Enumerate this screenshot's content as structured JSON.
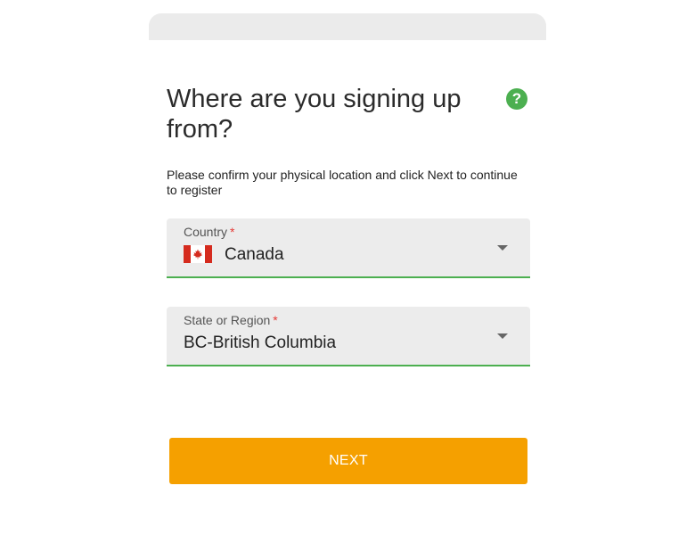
{
  "header": {
    "title": "Where are you signing up from?",
    "help_icon": "question-mark-icon",
    "help_symbol": "?"
  },
  "instructions": "Please confirm your physical location and click Next to continue to register",
  "form": {
    "country": {
      "label": "Country",
      "required_marker": "*",
      "value": "Canada",
      "flag_icon": "canada-flag-icon"
    },
    "state": {
      "label": "State or Region",
      "required_marker": "*",
      "value": "BC-British Columbia"
    }
  },
  "actions": {
    "next_label": "NEXT"
  },
  "colors": {
    "accent_green": "#4caf50",
    "button_orange": "#f5a000",
    "required_red": "#e53935",
    "field_background": "#ececec"
  }
}
